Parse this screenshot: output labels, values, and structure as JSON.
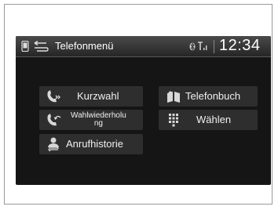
{
  "header": {
    "title": "Telefonmenü",
    "clock": "12:34"
  },
  "menu": {
    "speed_dial": "Kurzwahl",
    "phonebook": "Telefonbuch",
    "redial_line1": "Wahlwiederholu",
    "redial_line2": "ng",
    "dial": "Wählen",
    "call_history": "Anrufhistorie"
  },
  "icons": {
    "phone": "phone-icon",
    "back": "back-icon",
    "bluetooth": "bluetooth-icon",
    "signal": "signal-strength-icon",
    "speed_dial": "speed-dial-icon",
    "phonebook": "phonebook-icon",
    "redial": "redial-icon",
    "keypad": "keypad-icon",
    "call_history": "call-history-icon"
  },
  "colors": {
    "screen_background": "#151515",
    "button_background": "#2e2e2e",
    "text": "#ffffff"
  }
}
